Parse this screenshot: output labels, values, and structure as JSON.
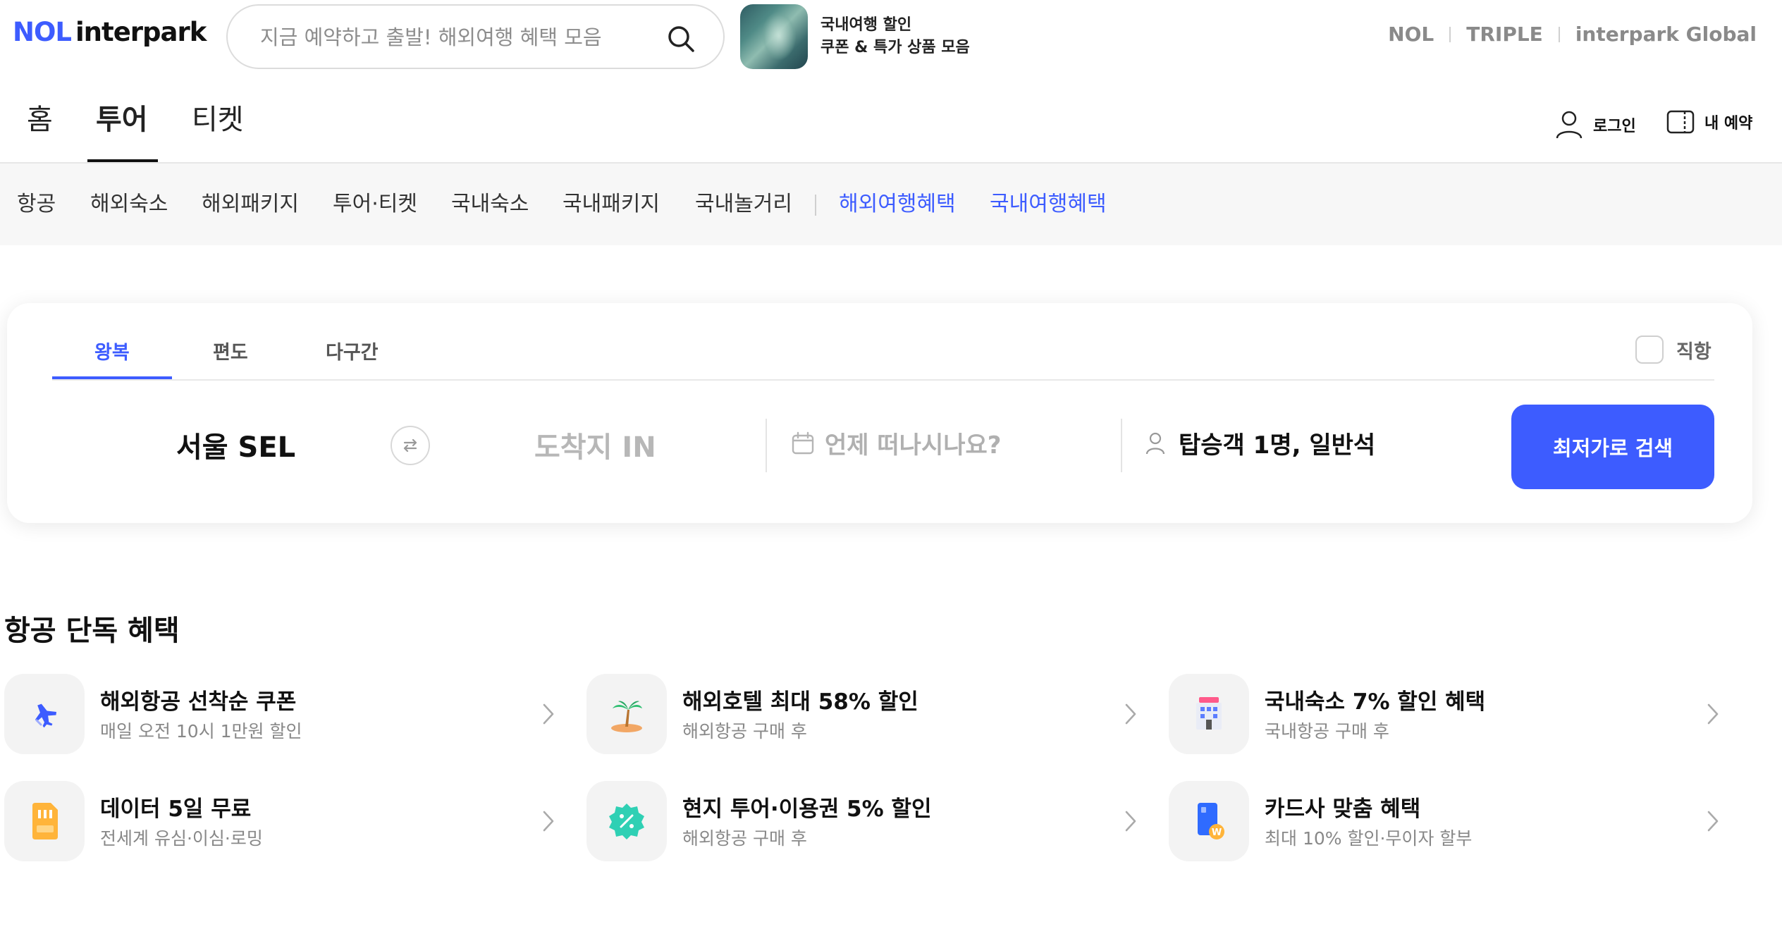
{
  "header": {
    "logo_primary": "NOL",
    "logo_secondary": "interpark",
    "search_placeholder": "지금 예약하고 출발! 해외여행 혜택 모음",
    "promo_line1": "국내여행 할인",
    "promo_line2": "쿠폰 & 특가 상품 모음",
    "brand_links": [
      "NOL",
      "TRIPLE",
      "interpark Global"
    ]
  },
  "main_nav": {
    "tabs": [
      "홈",
      "투어",
      "티켓"
    ],
    "active_tab": "투어",
    "login_label": "로그인",
    "my_booking_label": "내 예약"
  },
  "sub_nav": {
    "items": [
      "항공",
      "해외숙소",
      "해외패키지",
      "투어·티켓",
      "국내숙소",
      "국내패키지",
      "국내놀거리"
    ],
    "highlight_items": [
      "해외여행혜택",
      "국내여행혜택"
    ],
    "highlight_color": "#3d5cff"
  },
  "flight_search": {
    "trip_tabs": [
      "왕복",
      "편도",
      "다구간"
    ],
    "active_trip_tab": "왕복",
    "direct_label": "직항",
    "direct_checked": false,
    "origin": "서울 SEL",
    "destination_placeholder": "도착지 IN",
    "date_placeholder": "언제 떠나시나요?",
    "passengers": "탑승객 1명, 일반석",
    "search_button": "최저가로 검색",
    "accent_color": "#3d5cff"
  },
  "benefits": {
    "title": "항공 단독 혜택",
    "items": [
      {
        "title": "해외항공 선착순 쿠폰",
        "subtitle": "매일 오전 10시 1만원 할인",
        "icon": "airplane-icon"
      },
      {
        "title": "해외호텔 최대 58% 할인",
        "subtitle": "해외항공 구매 후",
        "icon": "palm-tree-icon"
      },
      {
        "title": "국내숙소 7% 할인 혜택",
        "subtitle": "국내항공 구매 후",
        "icon": "hotel-building-icon"
      },
      {
        "title": "데이터 5일 무료",
        "subtitle": "전세계 유심·이심·로밍",
        "icon": "sim-card-icon"
      },
      {
        "title": "현지 투어·이용권 5% 할인",
        "subtitle": "해외항공 구매 후",
        "icon": "discount-badge-icon"
      },
      {
        "title": "카드사 맞춤 혜택",
        "subtitle": "최대 10% 할인·무이자 할부",
        "icon": "credit-card-icon"
      }
    ]
  }
}
